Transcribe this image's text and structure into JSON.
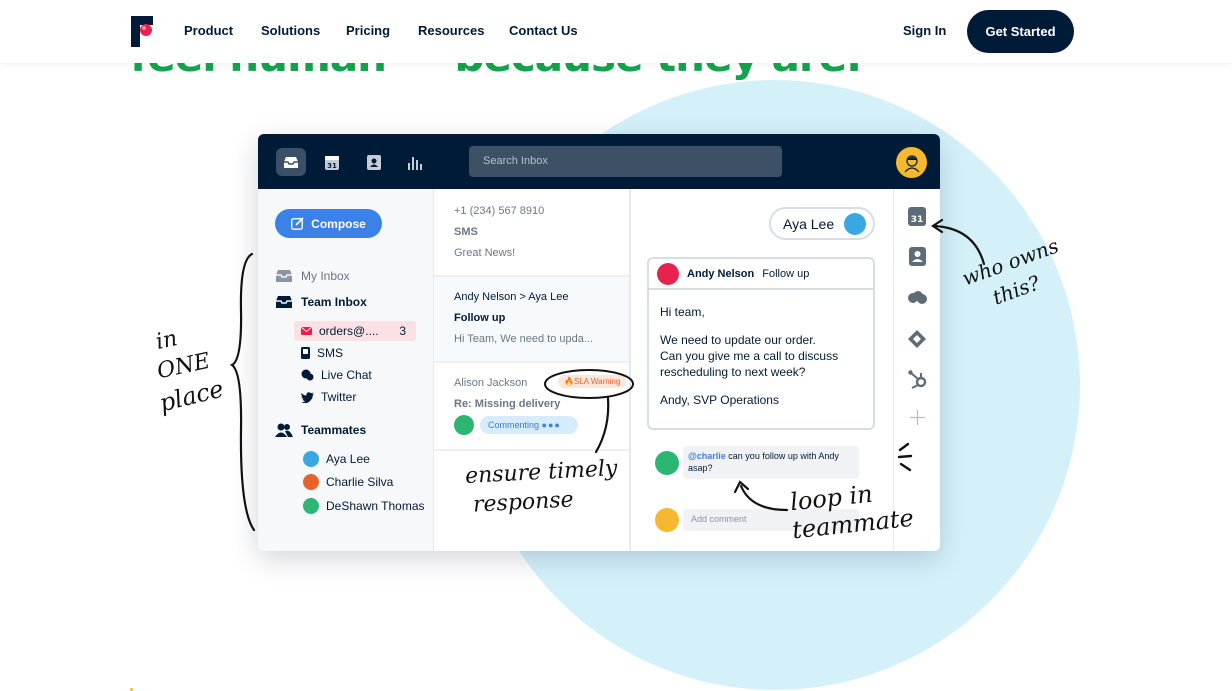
{
  "nav": {
    "links": [
      "Product",
      "Solutions",
      "Pricing",
      "Resources",
      "Contact Us"
    ],
    "sign_in": "Sign In",
    "get_started": "Get Started"
  },
  "hero": {
    "heading": "feel human — because they are."
  },
  "app": {
    "search_placeholder": "Search Inbox",
    "compose": "Compose",
    "my_inbox": "My Inbox",
    "team_inbox": "Team Inbox",
    "channels": [
      {
        "label": "orders@....",
        "count": "3",
        "icon": "envelope-icon"
      },
      {
        "label": "SMS",
        "icon": "phone-icon"
      },
      {
        "label": "Live Chat",
        "icon": "chat-icon"
      },
      {
        "label": "Twitter",
        "icon": "twitter-icon"
      }
    ],
    "teammates_label": "Teammates",
    "teammates": [
      {
        "name": "Aya Lee",
        "color": "#3aa8e0"
      },
      {
        "name": "Charlie Silva",
        "color": "#e8632b"
      },
      {
        "name": "DeShawn Thomas",
        "color": "#2bb673"
      }
    ],
    "messages": [
      {
        "from": "+1 (234) 567 8910",
        "subject": "SMS",
        "preview": "Great News!"
      },
      {
        "from": "Andy Nelson > Aya Lee",
        "subject": "Follow up",
        "preview": "Hi Team, We need to upda..."
      },
      {
        "from": "Alison Jackson",
        "subject": "Re: Missing delivery",
        "badge": "🔥SLA Warning",
        "status": "Commenting"
      }
    ],
    "assignee": "Aya Lee",
    "conversation": {
      "sender": "Andy Nelson",
      "subject": "Follow up",
      "greeting": "Hi team,",
      "body_1": "We need to update our order.",
      "body_2": "Can you give me a call to discuss",
      "body_3": "rescheduling to next week?",
      "signature": "Andy, SVP Operations",
      "comment_mention": "@charlie",
      "comment_text": " can you follow up with Andy asap?",
      "add_comment_placeholder": "Add comment"
    },
    "right_rail_icons": [
      "calendar-icon",
      "contact-icon",
      "salesforce-icon",
      "jira-icon",
      "hubspot-icon",
      "plus-icon"
    ],
    "calendar_day": "31"
  },
  "annotations": {
    "in_one_place": [
      "in",
      "ONE",
      "place"
    ],
    "who_owns": [
      "who owns",
      "this?"
    ],
    "ensure": [
      "ensure timely",
      "response"
    ],
    "loop": [
      "loop in",
      "teammate"
    ]
  },
  "colors": {
    "brand_navy": "#001b38",
    "accent_green": "#14a44d",
    "circle_blue": "#d4f1fa",
    "compose_blue": "#3b82e8"
  }
}
